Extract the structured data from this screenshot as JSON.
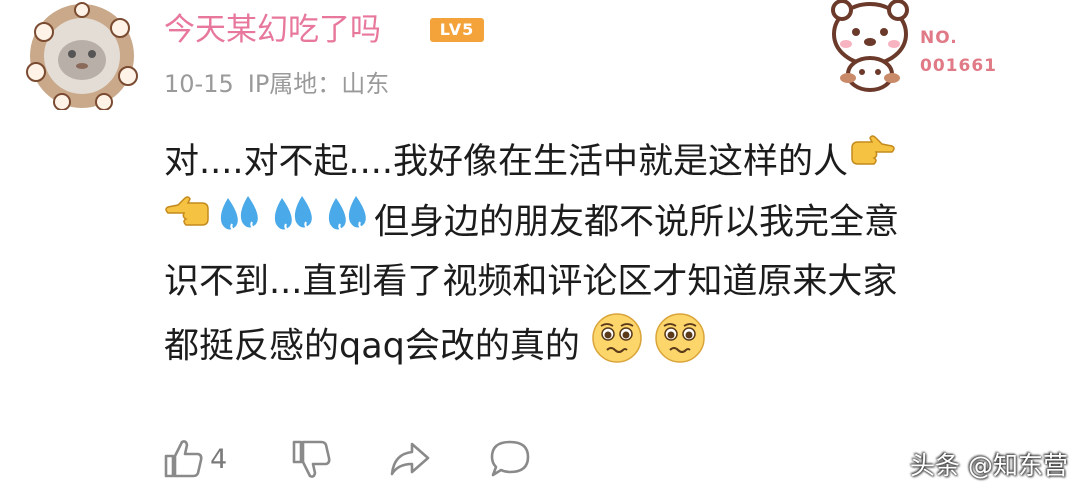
{
  "comment": {
    "username": "今天某幻吃了吗",
    "level": "LV5",
    "date": "10-15",
    "ip_location": "IP属地：山东",
    "fan_badge": {
      "label": "NO.",
      "number": "001661"
    },
    "text": {
      "line1": "对....对不起....我好像在生活中就是这样的人",
      "line2": "但身边的朋友都不说所以我完全意",
      "line3": "识不到...直到看了视频和评论区才知道原来大家",
      "line4": "都挺反感的qaq会改的真的"
    },
    "emoji": {
      "pointing_right": "pointing-right-hand",
      "pointing_left": "pointing-left-hand",
      "sweat_drops": "sweat-droplets",
      "pleading_face": "pleading-face"
    },
    "actions": {
      "like_count": "4"
    }
  },
  "watermark": "头条 @知东营",
  "colors": {
    "username": "#e8789b",
    "level_badge": "#f3a33a",
    "meta": "#9a9a9a",
    "icon_stroke": "#8a8a8a"
  }
}
